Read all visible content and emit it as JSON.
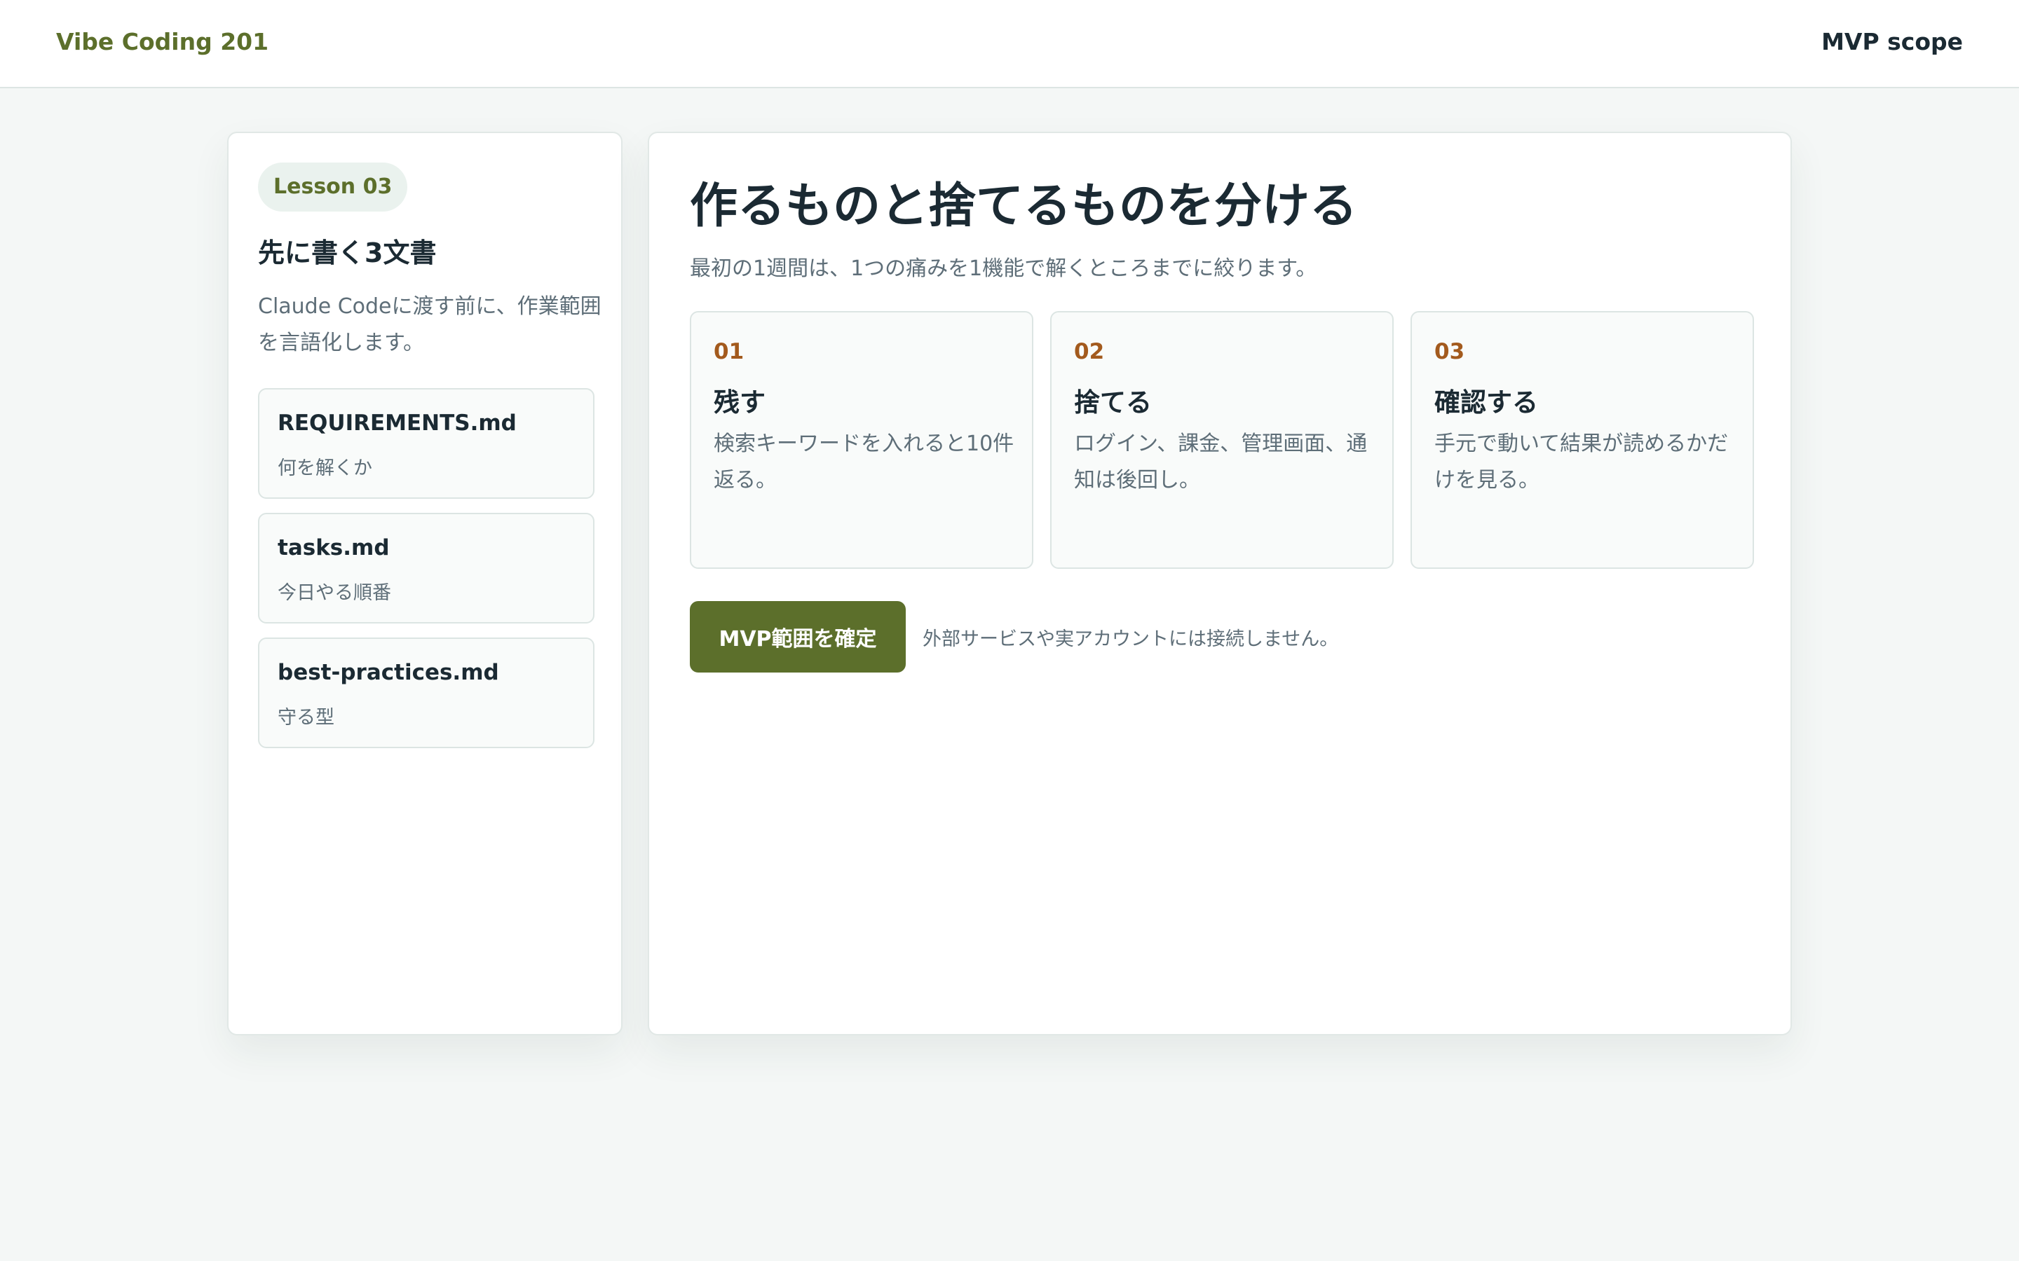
{
  "header": {
    "brand": "Vibe Coding 201",
    "right_label": "MVP scope"
  },
  "sidebar": {
    "badge": "Lesson 03",
    "title": "先に書く3文書",
    "description": "Claude Codeに渡す前に、作業範囲を言語化します。",
    "docs": [
      {
        "name": "REQUIREMENTS.md",
        "sub": "何を解くか"
      },
      {
        "name": "tasks.md",
        "sub": "今日やる順番"
      },
      {
        "name": "best-practices.md",
        "sub": "守る型"
      }
    ]
  },
  "main": {
    "title": "作るものと捨てるものを分ける",
    "subtitle": "最初の1週間は、1つの痛みを1機能で解くところまでに絞ります。",
    "steps": [
      {
        "num": "01",
        "title": "残す",
        "desc": "検索キーワードを入れると10件返る。"
      },
      {
        "num": "02",
        "title": "捨てる",
        "desc": "ログイン、課金、管理画面、通知は後回し。"
      },
      {
        "num": "03",
        "title": "確認する",
        "desc": "手元で動いて結果が読めるかだけを見る。"
      }
    ],
    "confirm_button": "MVP範囲を確定",
    "button_note": "外部サービスや実アカウントには接続しません。"
  },
  "colors": {
    "accent": "#5c6f2b",
    "step_number": "#a35a1d",
    "background": "#f4f7f6"
  }
}
